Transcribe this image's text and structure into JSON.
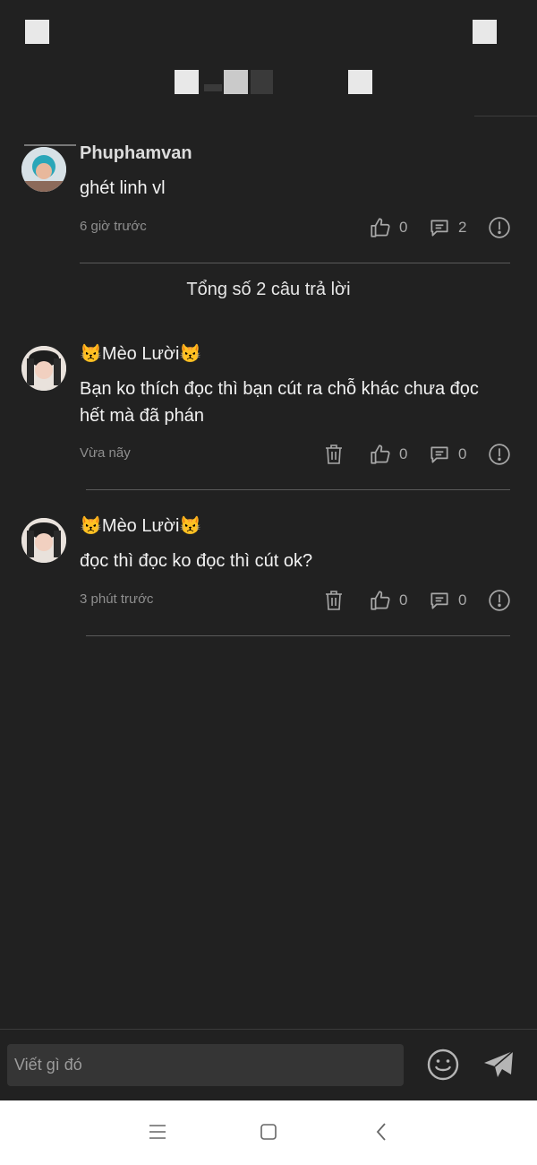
{
  "thread": {
    "parent": {
      "author": "Phuphamvan",
      "text": "ghét linh vl",
      "time": "6 giờ trước",
      "likes": "0",
      "replies": "2"
    },
    "total_label": "Tổng số 2 câu trả lời",
    "replies": [
      {
        "author": "😾Mèo Lười😾",
        "text": "Bạn ko thích đọc thì bạn cút ra chỗ khác chưa đọc hết mà đã phán",
        "time": "Vừa nãy",
        "likes": "0",
        "replies": "0"
      },
      {
        "author": "😾Mèo Lười😾",
        "text": "đọc thì đọc ko đọc thì cút ok?",
        "time": "3 phút trước",
        "likes": "0",
        "replies": "0"
      }
    ]
  },
  "composer": {
    "placeholder": "Viết gì đó"
  },
  "icons": {
    "like": "thumbs-up-icon",
    "reply": "speech-bubble-icon",
    "report": "exclamation-circle-icon",
    "delete": "trash-icon",
    "emoji": "smiley-icon",
    "send": "paper-plane-icon",
    "menu": "menu-lines-icon",
    "home": "home-square-icon",
    "back": "back-chevron-icon"
  },
  "colors": {
    "background": "#212121",
    "text": "#f2f2f2",
    "muted": "#8f8f8f",
    "icon": "#a8a8a8",
    "navbar": "#ffffff"
  }
}
